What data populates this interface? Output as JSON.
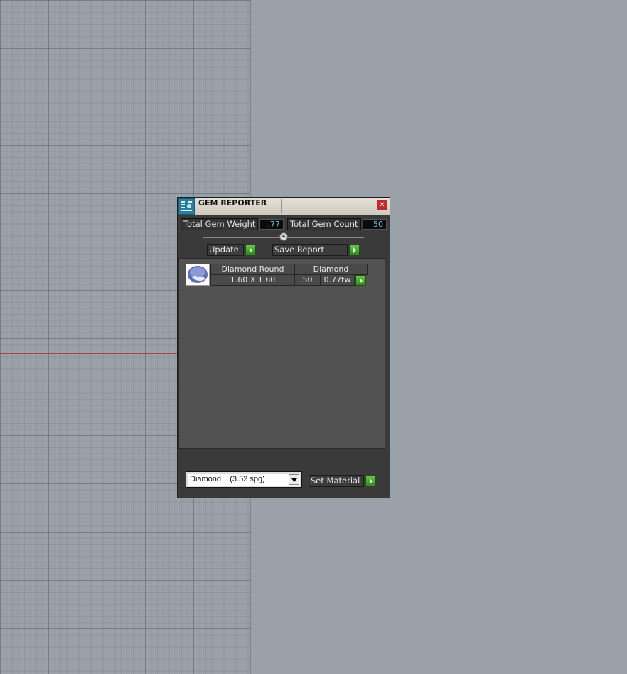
{
  "window": {
    "title": "GEM REPORTER",
    "close_glyph": "✕"
  },
  "summary": {
    "total_weight_label": "Total Gem Weight",
    "total_weight_value": ".77",
    "total_count_label": "Total Gem Count",
    "total_count_value": "50"
  },
  "actions": {
    "update_label": "Update",
    "save_report_label": "Save Report",
    "set_material_label": "Set Material"
  },
  "gems": [
    {
      "shape": "Diamond Round",
      "material": "Diamond",
      "size": "1.60 X 1.60",
      "count": "50",
      "weight": "0.77tw",
      "icon": "round-gem-icon"
    }
  ],
  "material_select": {
    "selected": "Diamond    (3.52 spg)"
  },
  "colors": {
    "panel_bg": "#3a3a3a",
    "value_text": "#6ec6e6",
    "go_button": "#3fa02a",
    "close_button": "#c02a2a",
    "viewport_bg": "#9aa1a8",
    "axis_line": "#b04040"
  }
}
